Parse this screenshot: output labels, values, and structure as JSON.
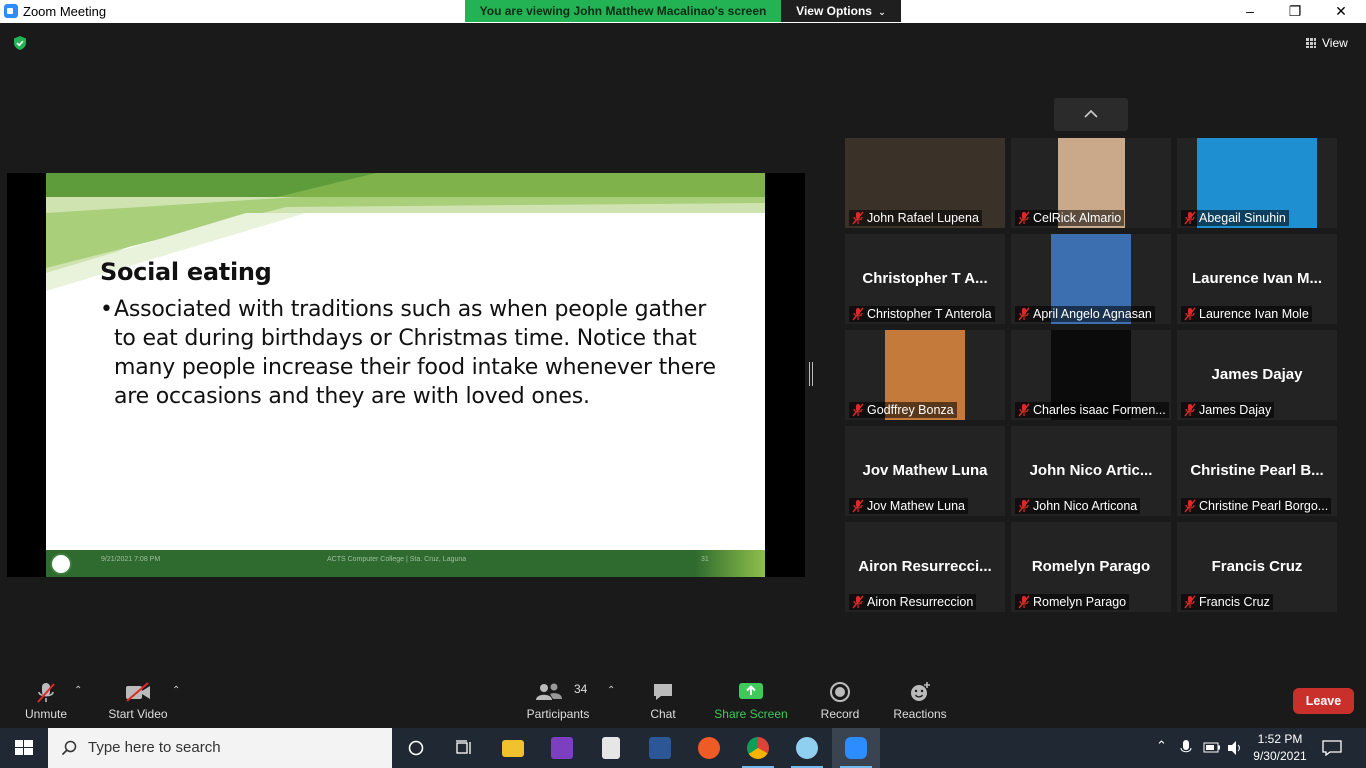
{
  "window": {
    "title": "Zoom Meeting",
    "banner": "You are viewing John Matthew Macalinao's screen",
    "view_options": "View Options",
    "controls": {
      "minimize": "–",
      "restore": "❐",
      "close": "✕"
    }
  },
  "top": {
    "view_label": "View"
  },
  "slide": {
    "title": "Social eating",
    "bullet": "Associated with traditions such as when people gather to eat during birthdays or Christmas time. Notice that many people increase their food intake whenever there are occasions and they are with loved ones.",
    "footer_date": "9/21/2021 7:08 PM",
    "footer_center": "ACTS Computer College | Sta. Cruz, Laguna",
    "footer_page": "31"
  },
  "participants": [
    {
      "display": "",
      "name": "John Rafael Lupena",
      "video": true
    },
    {
      "display": "",
      "name": "CelRick Almario",
      "video": true
    },
    {
      "display": "",
      "name": "Abegail Sinuhin",
      "video": true
    },
    {
      "display": "Christopher T A...",
      "name": "Christopher T Anterola",
      "video": false
    },
    {
      "display": "",
      "name": "April Angelo Agnasan",
      "video": true
    },
    {
      "display": "Laurence Ivan M...",
      "name": "Laurence Ivan Mole",
      "video": false
    },
    {
      "display": "",
      "name": "Godffrey Bonza",
      "video": true
    },
    {
      "display": "",
      "name": "Charles isaac Formen...",
      "video": true
    },
    {
      "display": "James Dajay",
      "name": "James Dajay",
      "video": false
    },
    {
      "display": "Jov Mathew  Luna",
      "name": "Jov Mathew  Luna",
      "video": false
    },
    {
      "display": "John  Nico  Artic...",
      "name": "John Nico Articona",
      "video": false
    },
    {
      "display": "Christine  Pearl  B...",
      "name": "Christine Pearl Borgo...",
      "video": false
    },
    {
      "display": "Airon  Resurrecci...",
      "name": "Airon Resurreccion",
      "video": false
    },
    {
      "display": "Romelyn Parago",
      "name": "Romelyn Parago",
      "video": false
    },
    {
      "display": "Francis Cruz",
      "name": "Francis Cruz",
      "video": false
    }
  ],
  "toolbar": {
    "unmute": "Unmute",
    "start_video": "Start Video",
    "participants": "Participants",
    "participants_count": "34",
    "chat": "Chat",
    "share_screen": "Share Screen",
    "record": "Record",
    "reactions": "Reactions",
    "leave": "Leave"
  },
  "taskbar": {
    "search_placeholder": "Type here to search",
    "time": "1:52 PM",
    "date": "9/30/2021"
  },
  "colors": {
    "banner_green": "#23b355",
    "share_green": "#3ec95a",
    "leave_red": "#c9302c",
    "mute_red": "#e02828"
  }
}
